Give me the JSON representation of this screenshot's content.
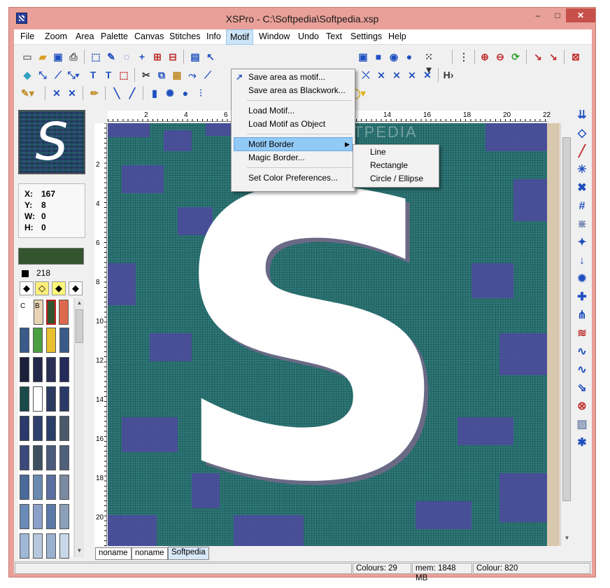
{
  "window": {
    "title": "XSPro - C:\\Softpedia\\Softpedia.xsp",
    "min": "–",
    "max": "□",
    "close": "✕"
  },
  "menubar": [
    "File",
    "Zoom",
    "Area",
    "Palette",
    "Canvas",
    "Stitches",
    "Info",
    "Motif",
    "Window",
    "Undo",
    "Text",
    "Settings",
    "Help"
  ],
  "motif_menu": {
    "items": [
      "Save area as motif...",
      "Save area as Blackwork...",
      "Load Motif...",
      "Load Motif as Object",
      "Motif Border",
      "Magic Border...",
      "Set Color Preferences..."
    ],
    "highlighted": "Motif Border"
  },
  "motif_border_submenu": [
    "Line",
    "Rectangle",
    "Circle / Ellipse"
  ],
  "preview": {
    "glyph": "S"
  },
  "coords": {
    "x_label": "X:",
    "x": "167",
    "y_label": "Y:",
    "y": "8",
    "w_label": "W:",
    "w": "0",
    "h_label": "H:",
    "h": "0"
  },
  "palette": {
    "current_color": "#33542f",
    "color_number": "218",
    "labels": {
      "c": "C",
      "b": "B"
    },
    "top_row": [
      "#e8d4b4",
      "#33542f",
      "#dd6a4e"
    ],
    "rows": [
      [
        "#3a5a8a",
        "#4aa040",
        "#e8c030",
        "#3a5a8a"
      ],
      [
        "#1a1f3a",
        "#22284a",
        "#2a2f55",
        "#242a5a"
      ],
      [
        "#1a4a4a",
        "#ffffff",
        "#2a3a60",
        "#2a3a68"
      ],
      [
        "#2a3a6a",
        "#30406e",
        "#2a3e6a",
        "#4a5a6a"
      ],
      [
        "#3a4a7a",
        "#3e5060",
        "#4a5a7a",
        "#50607a"
      ],
      [
        "#4a6a9a",
        "#6a8ab0",
        "#5a70a0",
        "#7a8aa0"
      ],
      [
        "#6a8ab8",
        "#8aa0c8",
        "#5a7aa8",
        "#8aa0b8"
      ],
      [
        "#a0b8d8",
        "#b8c8e0",
        "#9ab0d0",
        "#c8d8e8"
      ]
    ]
  },
  "ruler": {
    "h": [
      "2",
      "4",
      "6",
      "8",
      "10",
      "12",
      "14",
      "16",
      "18",
      "20",
      "22"
    ],
    "v": [
      "2",
      "4",
      "6",
      "8",
      "10",
      "12",
      "14",
      "16",
      "18",
      "20"
    ]
  },
  "watermark": "SOFTPEDIA",
  "tabs": [
    "noname",
    "noname",
    "Softpedia"
  ],
  "status": {
    "colours": "Colours: 29",
    "mem": "mem: 1848 MB",
    "colour": "Colour: 820"
  },
  "colors": {
    "title_bg": "#e8a098",
    "canvas_teal": "#2e7a7a",
    "canvas_purple": "#4b4b9b",
    "menu_highlight": "#91c9f7"
  }
}
